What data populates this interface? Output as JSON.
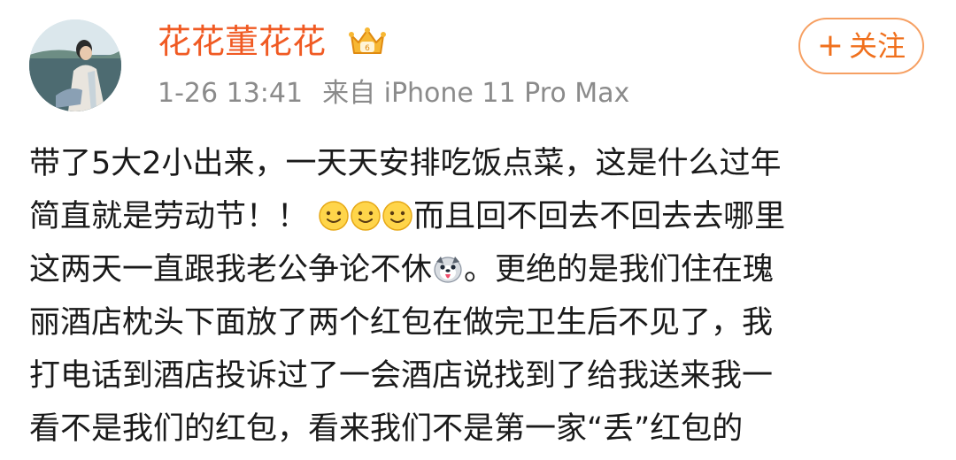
{
  "post": {
    "username": "花花董花花",
    "time": "1-26 13:41",
    "source": "来自 iPhone 11 Pro Max",
    "follow_plus": "+",
    "follow_label": "关注",
    "lines": [
      [
        "带了5大2小出来，一天天安排吃饭点菜，这是什么过年"
      ],
      [
        "简直就是劳动节！！",
        "而且回不回去不回去去哪里"
      ],
      [
        "这两天一直跟我老公争论不休",
        "。更绝的是我们住在瑰"
      ],
      [
        "丽酒店枕头下面放了两个红包在做完卫生后不见了，我"
      ],
      [
        "打电话到酒店投诉过了一会酒店说找到了给我送来我一"
      ],
      [
        "看不是我们的红包，看来我们不是第一家“丢”红包的"
      ]
    ]
  },
  "colors": {
    "username": "#f05a23",
    "meta": "#8b8b8b",
    "follow_border": "#f6a063",
    "text": "#1a1a1a"
  },
  "icons": {
    "crown": "vip-crown-icon",
    "smile": "smile-emoji-icon",
    "dog": "dog-tongue-emoji-icon"
  }
}
